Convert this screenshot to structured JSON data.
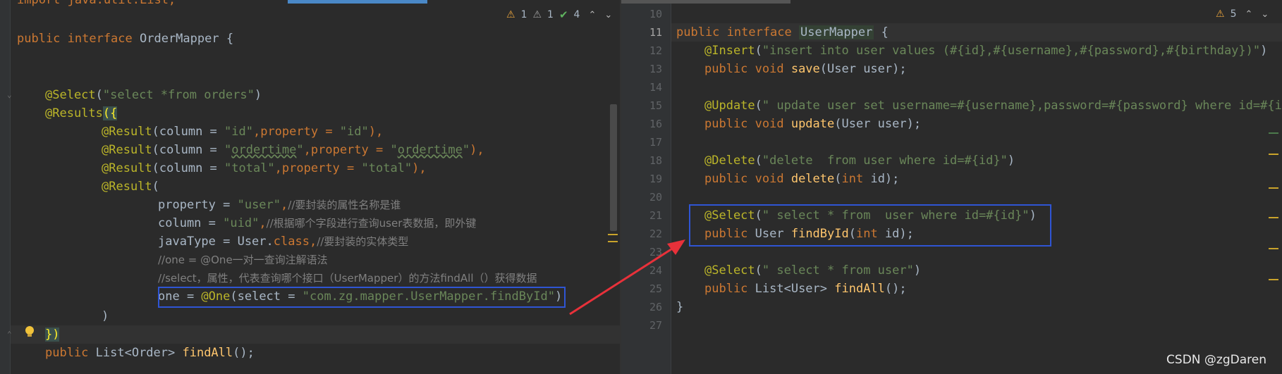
{
  "left_editor": {
    "top_partial": "import java.util.List;",
    "inspections": {
      "warn_count": "1",
      "weak_warn_count": "1",
      "ok_count": "4"
    },
    "lines": {
      "l1_kw": "public interface ",
      "l1_name": "OrderMapper",
      "l1_rest": " {",
      "sel_ann": "@Select",
      "sel_p1": "(",
      "sel_str": "\"select *from orders\"",
      "sel_p2": ")",
      "res_ann": "@Results",
      "res_open": "({",
      "r1_ann": "@Result",
      "r1_a": "(column = ",
      "r1_s1": "\"id\"",
      "r1_b": ",property = ",
      "r1_s2": "\"id\"",
      "r1_c": "),",
      "r2_ann": "@Result",
      "r2_a": "(column = ",
      "r2_q1": "\"",
      "r2_s1": "ordertime",
      "r2_q2": "\"",
      "r2_b": ",property = ",
      "r2_q3": "\"",
      "r2_s2": "ordertime",
      "r2_q4": "\"",
      "r2_c": "),",
      "r3_ann": "@Result",
      "r3_a": "(column = ",
      "r3_s1": "\"total\"",
      "r3_b": ",property = ",
      "r3_s2": "\"total\"",
      "r3_c": "),",
      "r4_ann": "@Result",
      "r4_a": "(",
      "p_a": "property = ",
      "p_s": "\"user\"",
      "p_c": ",",
      "p_cm": "//要封装的属性名称是谁",
      "c_a": "column = ",
      "c_s": "\"uid\"",
      "c_c": ",",
      "c_cm": "//根据哪个字段进行查询user表数据，即外键",
      "j_a": "javaType = User.",
      "j_kw": "class",
      "j_c": ",",
      "j_cm": "//要封装的实体类型",
      "cm1": "//one = @One一对一查询注解语法",
      "cm2": "//select，属性，代表查询哪个接口（UserMapper）的方法findAll（）获得数据",
      "one_a": "one = ",
      "one_ann": "@One",
      "one_b": "(select = ",
      "one_s": "\"com.zg.mapper.UserMapper.findById\"",
      "one_c": ")",
      "close_paren": ")",
      "close_brace": "})",
      "fa_kw": "public ",
      "fa_a": "List<Order> ",
      "fa_fn": "findAll",
      "fa_b": "();"
    }
  },
  "right_editor": {
    "inspections": {
      "warn_count": "5"
    },
    "line_numbers": [
      "10",
      "11",
      "12",
      "13",
      "14",
      "15",
      "16",
      "17",
      "18",
      "19",
      "20",
      "21",
      "22",
      "23",
      "24",
      "25",
      "26",
      "27"
    ],
    "lines": {
      "i_kw": "public interface ",
      "i_name": "UserMapper",
      "i_rest": " {",
      "ins_ann": "@Insert",
      "ins_p": "(",
      "ins_s": "\"insert into user values (#{id},#{username},#{password},#{birthday})\"",
      "ins_c": ")",
      "save_kw": "public void ",
      "save_fn": "save",
      "save_rest": "(User user);",
      "upd_ann": "@Update",
      "upd_p": "(",
      "upd_s": "\" update user set username=#{username},password=#{password} where id=#{id}\"",
      "upd_kw": "public void ",
      "upd_fn": "update",
      "upd_rest": "(User user);",
      "del_ann": "@Delete",
      "del_p": "(",
      "del_s": "\"delete  from user where id=#{id}\"",
      "del_c": ")",
      "del_kw": "public void ",
      "del_fn": "delete",
      "del_a": "(",
      "del_int": "int",
      "del_b": " id);",
      "s1_ann": "@Select",
      "s1_p": "(",
      "s1_s": "\" select * from  user where id=#{id}\"",
      "s1_c": ")",
      "fb_kw": "public ",
      "fb_a": "User ",
      "fb_fn": "findById",
      "fb_b": "(",
      "fb_int": "int",
      "fb_c": " id);",
      "s2_ann": "@Select",
      "s2_p": "(",
      "s2_s": "\" select * from user\"",
      "s2_c": ")",
      "fa_kw": "public ",
      "fa_a": "List<User> ",
      "fa_fn": "findAll",
      "fa_b": "();",
      "end": "}"
    }
  },
  "watermark": "CSDN @zgDaren",
  "colors": {
    "keyword": "#cc7832",
    "annotation": "#bbb529",
    "string": "#6a8759",
    "comment": "#808080",
    "method": "#ffc66d",
    "highlight_box": "#2f55d4",
    "arrow": "#e8313a"
  }
}
